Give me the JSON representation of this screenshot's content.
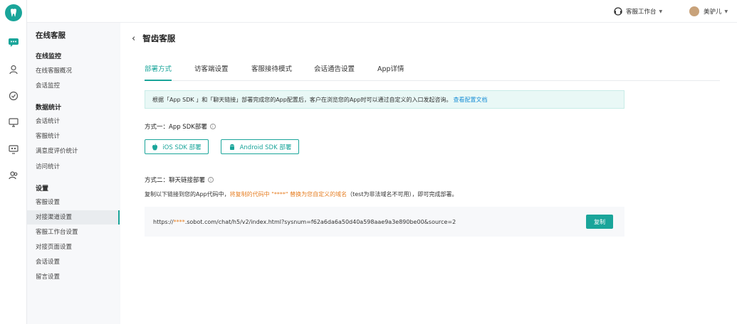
{
  "colors": {
    "accent": "#1aa59a",
    "warn": "#e67e22",
    "link": "#1a8fd6"
  },
  "topbar": {
    "workbench_label": "客服工作台",
    "user_name": "美驴儿"
  },
  "subnav": {
    "title": "在线客服",
    "sections": [
      {
        "label": "在线监控",
        "items": [
          "在线客服概况",
          "会话监控"
        ]
      },
      {
        "label": "数据统计",
        "items": [
          "会话统计",
          "客服统计",
          "满意度评价统计",
          "访问统计"
        ]
      },
      {
        "label": "设置",
        "items": [
          "客服设置",
          "对接渠道设置",
          "客服工作台设置",
          "对接页面设置",
          "会话设置",
          "留言设置"
        ]
      }
    ],
    "active_item": "对接渠道设置"
  },
  "page": {
    "title": "智齿客服",
    "tabs": [
      "部署方式",
      "访客端设置",
      "客服接待模式",
      "会话通告设置",
      "App详情"
    ],
    "notice": {
      "text": "根据「App SDK 」和「聊天链接」部署完成您的App配置后，客户在浏览您的App时可以通过自定义的入口发起咨询。",
      "link": "查看配置文档"
    },
    "method1": {
      "label": "方式一：App SDK部署",
      "ios_button": "iOS SDK 部署",
      "android_button": "Android SDK 部署"
    },
    "method2": {
      "label": "方式二：聊天链接部署",
      "desc_prefix": "复制以下链接到您的App代码中，",
      "desc_warn": "将复制的代码中 \"****\" 替换为您自定义的域名",
      "desc_suffix": "（test为非法域名不可用），即可完成部署。",
      "url_prefix": "https://",
      "url_stars": "****",
      "url_rest": ".sobot.com/chat/h5/v2/index.html?sysnum=f62a6da6a50d40a598aae9a3e890be00&source=2",
      "copy_button": "复制"
    }
  }
}
